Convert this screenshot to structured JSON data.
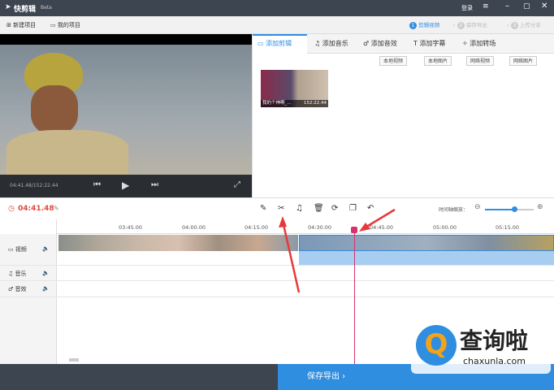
{
  "app": {
    "title": "快剪辑",
    "badge": "Beta",
    "login": "登录"
  },
  "toolbar": {
    "new_project": "新建项目",
    "my_projects": "我的项目",
    "steps": [
      {
        "num": "1",
        "label": "剪辑视频"
      },
      {
        "num": "2",
        "label": "保存导出"
      },
      {
        "num": "3",
        "label": "上传分享"
      }
    ]
  },
  "player": {
    "time": "04:41.48/152:22.44"
  },
  "panel": {
    "tabs": [
      "添加剪辑",
      "添加音乐",
      "添加音效",
      "添加字幕",
      "添加转场"
    ],
    "active_tab": 0,
    "sources": [
      "本地视频",
      "本地图片",
      "网络视频",
      "网络图片"
    ],
    "clip": {
      "name": "我的个神啊_...",
      "duration": "152:22.44"
    }
  },
  "timeline": {
    "current_time": "04:41.48",
    "zoom_label": "时间轴缩放：",
    "zoom_level": 0.6,
    "ticks": [
      "03:45.00",
      "04:00.00",
      "04:15.00",
      "04:30.00",
      "04:45.00",
      "05:00.00",
      "05:15.00"
    ],
    "tracks": [
      "视频",
      "音乐",
      "音效"
    ]
  },
  "footer": {
    "save_export": "保存导出"
  },
  "watermark": {
    "text": "查询啦",
    "url": "chaxunla.com"
  },
  "colors": {
    "accent": "#2f8ee0",
    "playhead": "#d6336c",
    "time": "#e04a3a"
  }
}
